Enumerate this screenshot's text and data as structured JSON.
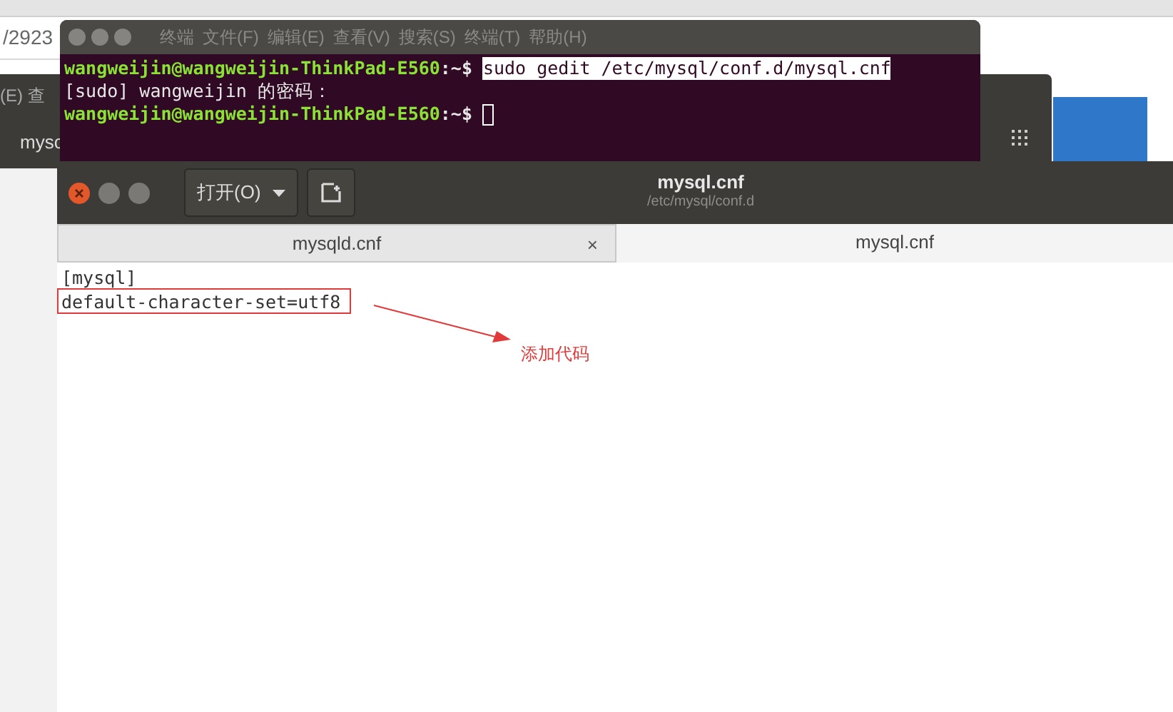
{
  "browser": {
    "url_fragment": "/2923"
  },
  "background_window": {
    "menu_fragment": "(E) 查",
    "tab_fragment": "mysc"
  },
  "terminal": {
    "menu": [
      "终端",
      "文件(F)",
      "编辑(E)",
      "查看(V)",
      "搜索(S)",
      "终端(T)",
      "帮助(H)"
    ],
    "lines": [
      {
        "kind": "prompt",
        "prompt": "wangweijin@wangweijin-ThinkPad-E560",
        "path": ":~$",
        "command": "sudo gedit /etc/mysql/conf.d/mysql.cnf",
        "selected": true
      },
      {
        "kind": "output",
        "text": "[sudo] wangweijin 的密码："
      },
      {
        "kind": "prompt",
        "prompt": "wangweijin@wangweijin-ThinkPad-E560",
        "path": ":~$",
        "cursor": true
      }
    ]
  },
  "editor": {
    "open_button": "打开(O)",
    "title": "mysql.cnf",
    "subtitle": "/etc/mysql/conf.d",
    "tabs": [
      {
        "label": "mysqld.cnf",
        "selected": false,
        "close": "×"
      },
      {
        "label": "mysql.cnf",
        "selected": true
      }
    ],
    "lines": [
      {
        "text": "[mysql]",
        "highlighted": false
      },
      {
        "text": "default-character-set=utf8",
        "highlighted": true
      }
    ],
    "annotation": {
      "text": "添加代码"
    }
  }
}
